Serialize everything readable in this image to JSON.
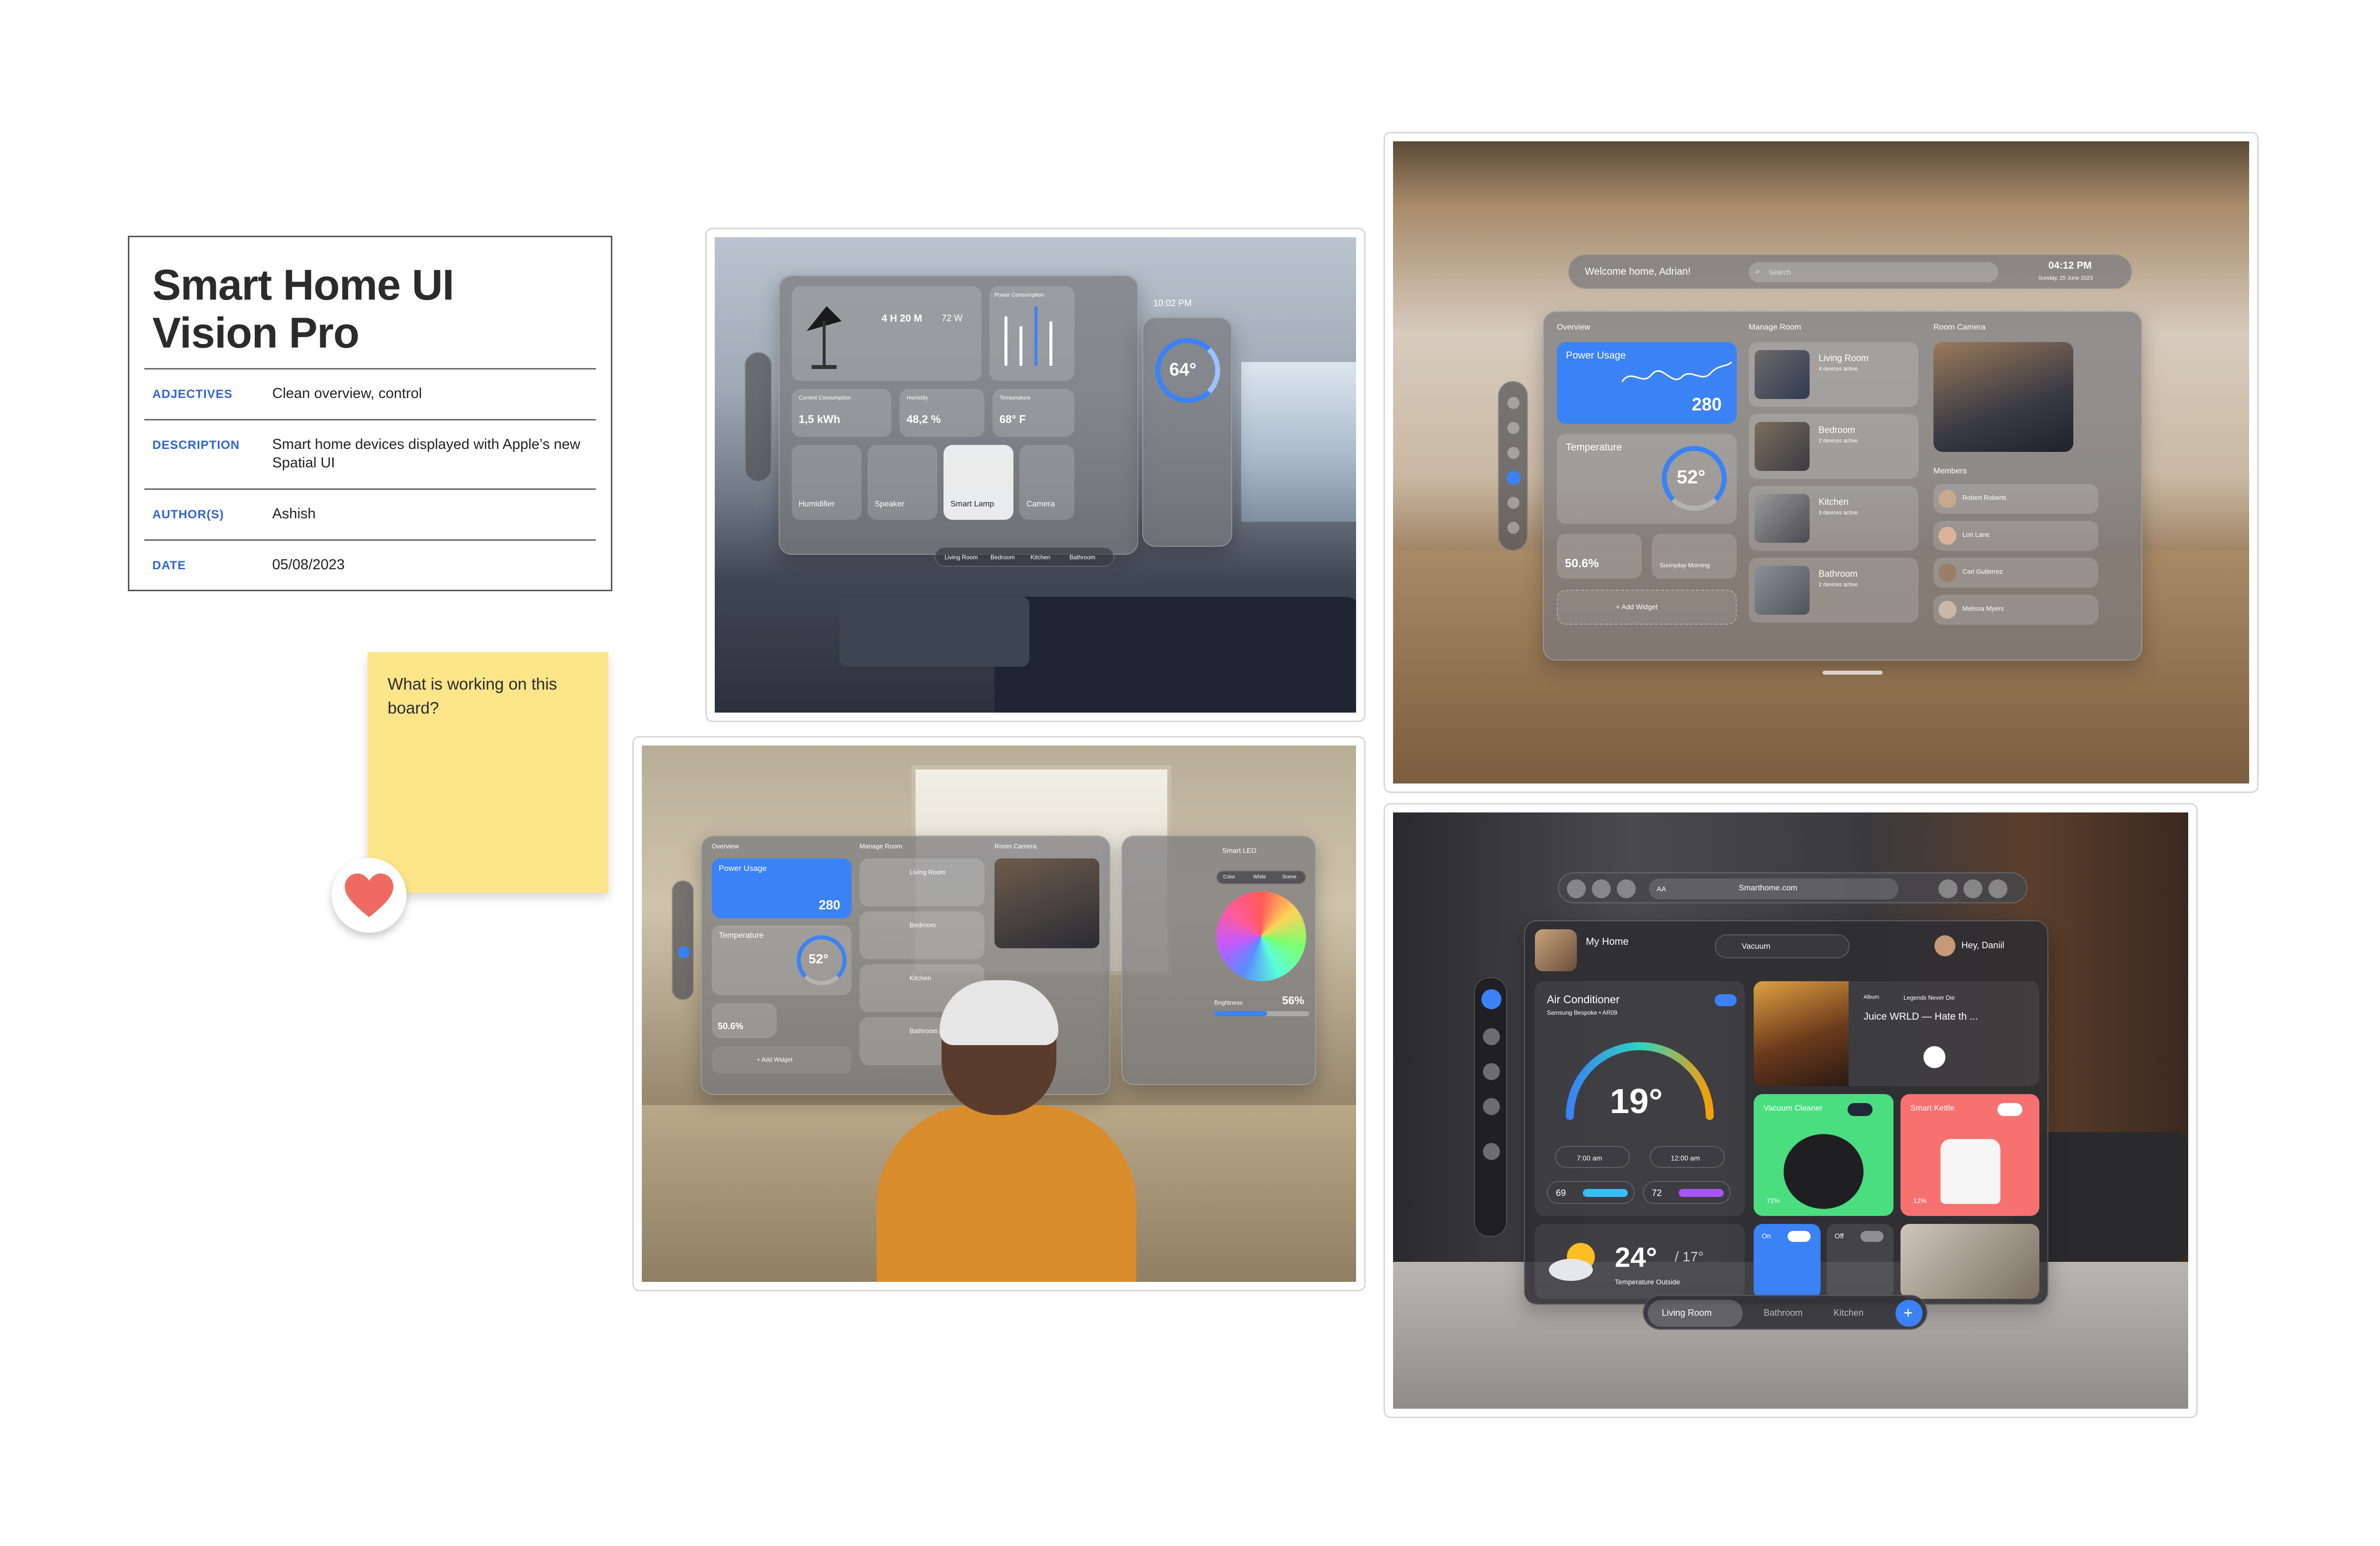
{
  "info_card": {
    "title_line1": "Smart Home UI",
    "title_line2": "Vision Pro",
    "rows": [
      {
        "label": "ADJECTIVES",
        "value": "Clean overview, control"
      },
      {
        "label": "DESCRIPTION",
        "value": "Smart home devices displayed with Apple’s new Spatial UI"
      },
      {
        "label": "AUTHOR(S)",
        "value": "Ashish"
      },
      {
        "label": "DATE",
        "value": "05/08/2023"
      }
    ]
  },
  "sticky_note": {
    "text": "What is working on this board?"
  },
  "colors": {
    "label_blue": "#2f64d6",
    "sticky_yellow": "#fde68a",
    "heart_red": "#ef6b62",
    "accent_blue": "#3b82f6"
  },
  "shot1": {
    "time": "10:02 PM",
    "duration": "4 H 20 M",
    "watts": "72 W",
    "power_consumption": "Power Consumption",
    "current_consumption": "Current Consumption",
    "kwh": "1,5 kWh",
    "humidity_label": "Humidity",
    "humidity": "48,2 %",
    "temperature_label": "Temperature",
    "temp_small": "68° F",
    "thermostat": "64°",
    "humidifier": "Humidifier",
    "speaker": "Speaker",
    "smart_lamp": "Smart Lamp",
    "camera": "Camera",
    "tabs": [
      "Living Room",
      "Bedroom",
      "Kitchen",
      "Bathroom"
    ]
  },
  "shot2": {
    "welcome": "Welcome home, Adrian!",
    "search_placeholder": "Search",
    "time": "04:12 PM",
    "date": "Sunday, 25 June 2023",
    "overview": "Overview",
    "power_usage": "Power Usage",
    "power_value": "280",
    "temperature": "Temperature",
    "temp_value": "52°",
    "humidity": "50.6%",
    "weather": "Sunnyday Morning",
    "add_widget": "+ Add Widget",
    "manage_room": "Manage Room",
    "rooms": [
      {
        "name": "Living Room",
        "sub": "4 devices active"
      },
      {
        "name": "Bedroom",
        "sub": "2 devices active"
      },
      {
        "name": "Kitchen",
        "sub": "3 devices active"
      },
      {
        "name": "Bathroom",
        "sub": "2 devices active"
      }
    ],
    "room_camera": "Room Camera",
    "members": "Members",
    "member_names": [
      "Robert Roberts",
      "Lori Lane",
      "Carl Gutierrez",
      "Melissa Myers"
    ]
  },
  "shot3": {
    "overview": "Overview",
    "power_usage": "Power Usage",
    "power_value": "280",
    "temperature": "Temperature",
    "temp_value": "52°",
    "humidity": "50.6%",
    "add_widget": "+ Add Widget",
    "manage_room": "Manage Room",
    "room_camera": "Room Camera",
    "rooms": [
      "Living Room",
      "Bedroom",
      "Kitchen",
      "Bathroom"
    ],
    "smart_led": "Smart LED",
    "brightness": "Brightness",
    "brightness_value": "56%",
    "light_tabs": [
      "Color",
      "White",
      "Scene"
    ]
  },
  "shot4": {
    "url": "Smarthome.com",
    "url_prefix": "AA",
    "my_home": "My Home",
    "vacuum": "Vacuum",
    "greeting": "Hey, Daniil",
    "ac_title": "Air Conditioner",
    "ac_sub": "Samsung Bespoke • AR09",
    "ac_temp": "19°",
    "ac_from": "7:00 am",
    "ac_to": "12:00 am",
    "range_low": "69",
    "range_high": "72",
    "album": "Album",
    "album_name": "Legends Never Die",
    "track": "Juice WRLD — Hate th ...",
    "vacuum_cleaner": "Vacuum Cleaner",
    "vacuum_battery": "72%",
    "smart_kettle": "Smart Kettle",
    "kettle_level": "12%",
    "weather_temp": "24°",
    "weather_low": "/ 17°",
    "weather_label": "Temperature Outside",
    "on_label": "On",
    "off_label": "Off",
    "tabs": [
      "Living Room",
      "Bathroom",
      "Kitchen"
    ]
  }
}
